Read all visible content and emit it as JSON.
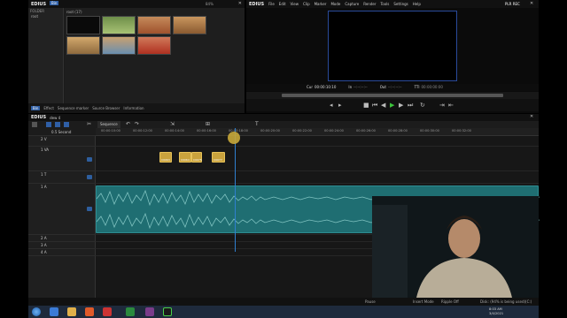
{
  "bin_window": {
    "brand": "EDIUS",
    "badge": "Bin",
    "folder_label": "FOLDER",
    "tree_root": "root",
    "path_label": "root (17)",
    "zoom": "84%"
  },
  "bin_tabs": [
    "Bin",
    "Effect",
    "Sequence marker",
    "Source Browser",
    "Information"
  ],
  "player_window": {
    "brand": "EDIUS",
    "menus": [
      "File",
      "Edit",
      "View",
      "Clip",
      "Marker",
      "Mode",
      "Capture",
      "Render",
      "Tools",
      "Settings",
      "Help"
    ],
    "mode_badge": "PLR REC",
    "cur_label": "Cur",
    "cur_value": "00:00:10:10",
    "in_label": "In",
    "in_value": "--:--:--:--",
    "out_label": "Out",
    "out_value": "--:--:--:--",
    "tt_label": "TTl",
    "tt_value": "00:00:00:00"
  },
  "timeline": {
    "brand": "EDIUS",
    "project": "dew 4",
    "sequence_tab": "Sequence",
    "scale": "0.5 Second",
    "ruler_ticks": [
      "00:00:10:00",
      "00:00:12:00",
      "00:00:14:00",
      "00:00:16:00",
      "00:00:18:00",
      "00:00:20:00",
      "00:00:22:00",
      "00:00:24:00",
      "00:00:26:00",
      "00:00:28:00",
      "00:00:30:00",
      "00:00:32:00"
    ],
    "tracks": [
      {
        "name": "2 V"
      },
      {
        "name": "1 VA"
      },
      {
        "name": "1 T"
      },
      {
        "name": "1 A"
      },
      {
        "name": "2 A"
      },
      {
        "name": "3 A"
      },
      {
        "name": "4 A"
      }
    ],
    "video_clips": [
      {
        "label": "C0063"
      },
      {
        "label": "C0064"
      },
      {
        "label": "C0075"
      },
      {
        "label": "C0077"
      }
    ]
  },
  "status_bar": {
    "pause": "Pause",
    "insert_mode": "Insert Mode",
    "ripple": "Ripple Off",
    "disk": "Disk: (94% is being used)(C:)"
  },
  "taskbar": {
    "time": "8:03 AM",
    "date": "3/4/2021"
  },
  "colors": {
    "accent_blue": "#2f7fd0",
    "audio_waveform": "#1f6e72",
    "video_clip": "#c9a23d"
  }
}
